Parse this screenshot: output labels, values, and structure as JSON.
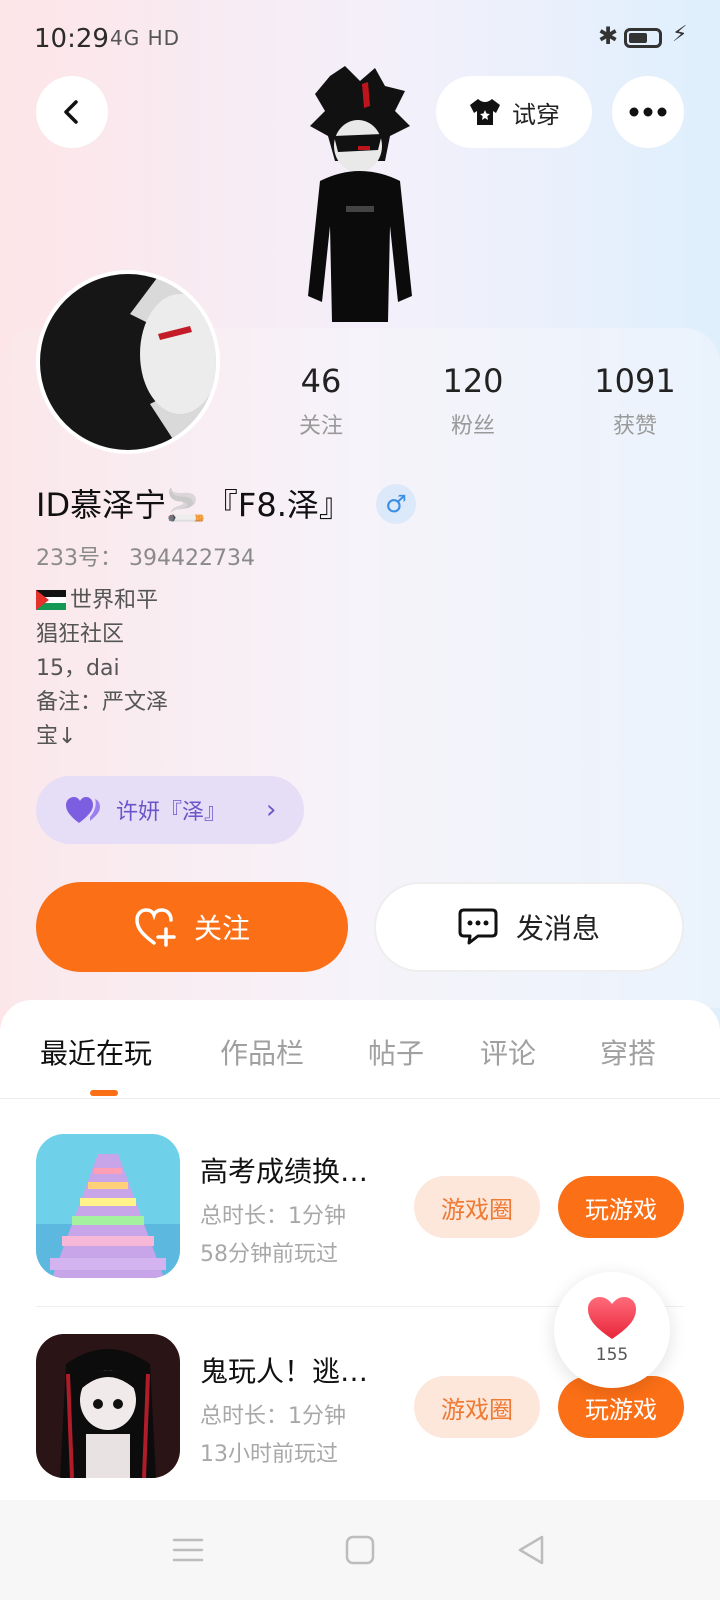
{
  "status_bar": {
    "time": "10:29",
    "network": "4G  HD",
    "bluetooth_icon": "bluetooth-icon",
    "battery_icon": "battery-icon",
    "charging_icon": "bolt-icon"
  },
  "header": {
    "back_icon": "back-chevron-icon",
    "tryon_label": "试穿",
    "tryon_icon": "tshirt-icon",
    "more_icon": "more-dots-icon"
  },
  "profile": {
    "stats": [
      {
        "value": "46",
        "label": "关注"
      },
      {
        "value": "120",
        "label": "粉丝"
      },
      {
        "value": "1091",
        "label": "获赞"
      }
    ],
    "name": "ID慕泽宁🚬『F8.泽』",
    "gender_symbol": "♂",
    "uid": "233号： 394422734",
    "bio": [
      "世界和平",
      "猖狂社区",
      "15，dai",
      "备注：严文泽",
      "宝↓"
    ],
    "cp_name": "许妍『泽』"
  },
  "actions": {
    "follow_label": "关注",
    "message_label": "发消息"
  },
  "tabs": [
    "最近在玩",
    "作品栏",
    "帖子",
    "评论",
    "穿搭"
  ],
  "games": [
    {
      "title": "高考成绩换…",
      "duration": "总时长：1分钟",
      "last_played": "58分钟前玩过",
      "circle_label": "游戏圈",
      "play_label": "玩游戏"
    },
    {
      "title": "鬼玩人！逃…",
      "duration": "总时长：1分钟",
      "last_played": "13小时前玩过",
      "circle_label": "游戏圈",
      "play_label": "玩游戏"
    }
  ],
  "like_count": "155",
  "colors": {
    "accent": "#fb6f16",
    "cp_bg": "#e6def6",
    "cp_text": "#6a56c9"
  }
}
